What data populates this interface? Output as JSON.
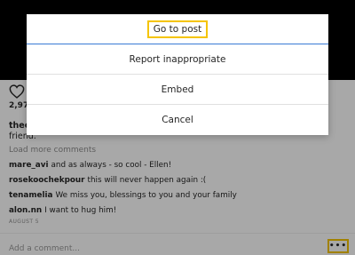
{
  "post": {
    "likes_text": "2,974",
    "caption_user": "theelle",
    "caption_continuation": "friend.",
    "load_more_label": "Load more comments",
    "comments": [
      {
        "user": "mare_avi",
        "text": "and as always - so cool - Ellen!"
      },
      {
        "user": "rosekoochekpour",
        "text": "this will never happen again :("
      },
      {
        "user": "tenamelia",
        "text": "We miss you, blessings to you and your family"
      },
      {
        "user": "alon.nn",
        "text": "I want to hug him!"
      }
    ],
    "date": "AUGUST 5",
    "add_comment_placeholder": "Add a comment...",
    "more_icon_glyph": "•••"
  },
  "menu": {
    "items": [
      "Go to post",
      "Report inappropriate",
      "Embed",
      "Cancel"
    ]
  },
  "colors": {
    "highlight": "#f5c400",
    "overlay": "rgba(0,0,0,0.34)",
    "focus_line": "#3a7bd5"
  },
  "icons": {
    "like": "heart-icon",
    "more": "more-options-icon"
  }
}
